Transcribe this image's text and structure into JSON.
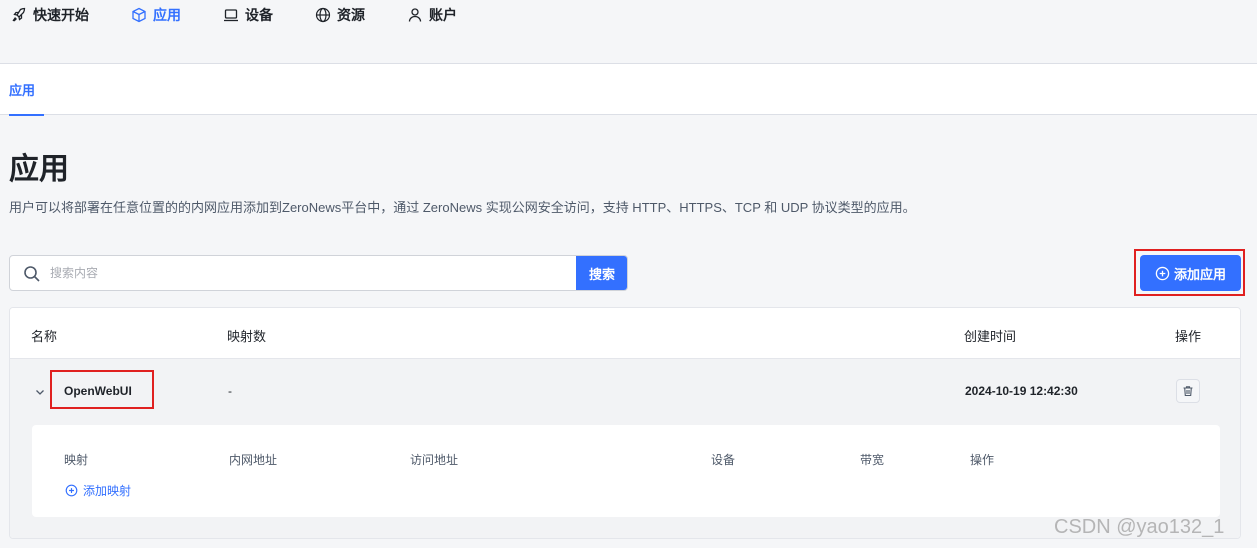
{
  "topnav": {
    "items": [
      {
        "label": "快速开始",
        "icon": "rocket-icon"
      },
      {
        "label": "应用",
        "icon": "cube-icon",
        "active": true
      },
      {
        "label": "设备",
        "icon": "laptop-icon"
      },
      {
        "label": "资源",
        "icon": "globe-icon"
      },
      {
        "label": "账户",
        "icon": "user-icon"
      }
    ]
  },
  "subnav": {
    "tab": "应用"
  },
  "page": {
    "title": "应用",
    "description": "用户可以将部署在任意位置的的内网应用添加到ZeroNews平台中，通过 ZeroNews 实现公网安全访问，支持 HTTP、HTTPS、TCP 和 UDP 协议类型的应用。"
  },
  "search": {
    "placeholder": "搜索内容",
    "value": "",
    "button_label": "搜索"
  },
  "add_app_button": "添加应用",
  "table": {
    "headers": {
      "name": "名称",
      "mappings": "映射数",
      "created": "创建时间",
      "actions": "操作"
    },
    "rows": [
      {
        "name": "OpenWebUI",
        "mappings": "-",
        "created": "2024-10-19 12:42:30",
        "expanded": true
      }
    ],
    "subtable": {
      "headers": {
        "mapping": "映射",
        "intranet": "内网地址",
        "access": "访问地址",
        "device": "设备",
        "bandwidth": "带宽",
        "actions": "操作"
      },
      "add_mapping_label": "添加映射"
    }
  },
  "colors": {
    "accent": "#3370ff",
    "highlight": "#e02020"
  },
  "watermark": "CSDN @yao132_1"
}
